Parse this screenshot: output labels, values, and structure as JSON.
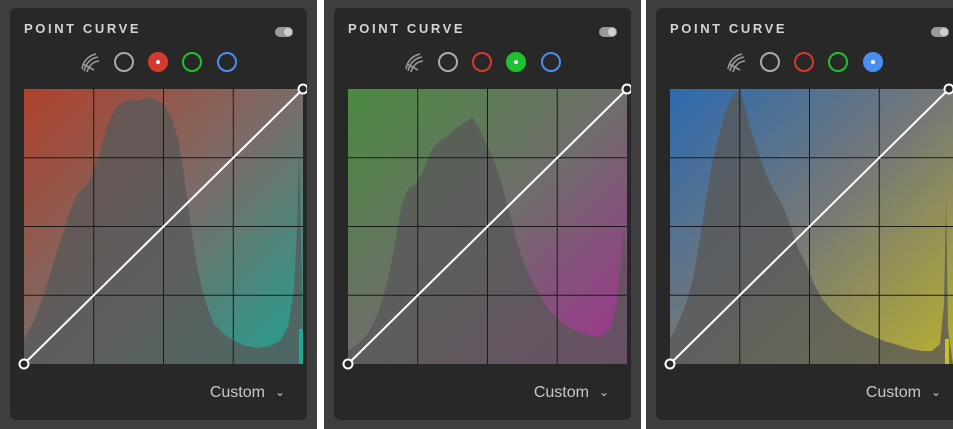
{
  "panels": [
    {
      "title": "POINT CURVE",
      "active_channel": "red",
      "preset_label": "Custom",
      "colors": {
        "top_left": "#b0402c",
        "bottom_right": "#1fa090",
        "base": "#7a6c68",
        "histogram": "#585858"
      }
    },
    {
      "title": "POINT CURVE",
      "active_channel": "green",
      "preset_label": "Custom",
      "colors": {
        "top_left": "#4a8a40",
        "bottom_right": "#a03090",
        "base": "#6e6e6a",
        "histogram": "#585858"
      }
    },
    {
      "title": "POINT CURVE",
      "active_channel": "blue",
      "preset_label": "Custom",
      "colors": {
        "top_left": "#2c6ab0",
        "bottom_right": "#b8b030",
        "base": "#767876",
        "histogram": "#585858"
      }
    }
  ],
  "channel_buttons": [
    {
      "name": "parametric",
      "icon": "parametric-icon"
    },
    {
      "name": "rgb",
      "color": "#aaaaaa"
    },
    {
      "name": "red",
      "color": "#d63a2e"
    },
    {
      "name": "green",
      "color": "#1ec22e"
    },
    {
      "name": "blue",
      "color": "#4a8ef0"
    }
  ],
  "preset_icon": "chevron-down-icon"
}
